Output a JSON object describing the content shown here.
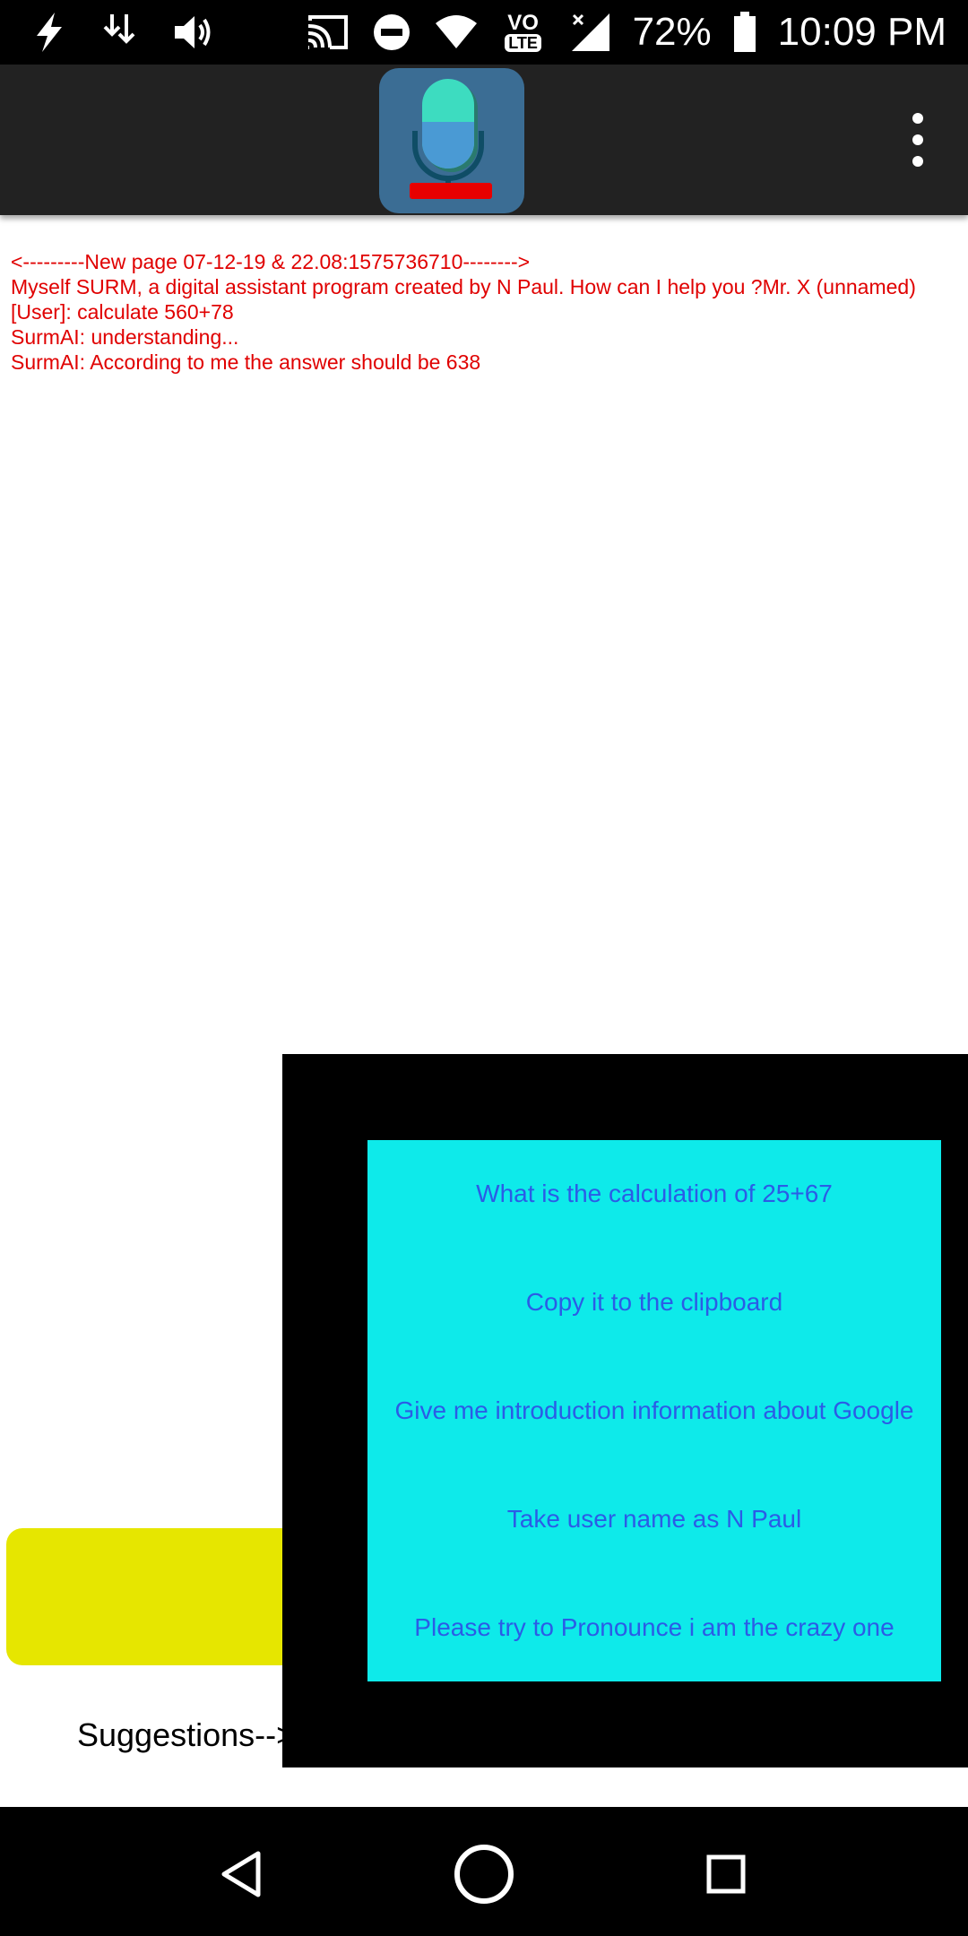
{
  "status_bar": {
    "battery_percent": "72%",
    "time": "10:09 PM",
    "network_badge": "LTE",
    "network_top": "VO",
    "icons": [
      "flash-icon",
      "download-icon",
      "volume-icon",
      "cast-icon",
      "do-not-disturb-icon",
      "wifi-icon",
      "volte-icon",
      "signal-icon",
      "battery-icon"
    ]
  },
  "app_bar": {
    "logo_icon": "microphone-icon",
    "menu_icon": "overflow-menu-icon"
  },
  "log": {
    "lines": [
      "<---------New page 07-12-19 & 22.08:1575736710-------->",
      "Myself SURM, a digital assistant program created by N Paul. How can I help you ?Mr. X (unnamed)",
      "[User]: calculate 560+78",
      "SurmAI: understanding...",
      "SurmAI: According to me the answer should be 638"
    ]
  },
  "suggestions": {
    "label": "Suggestions-->",
    "items": [
      "What is the calculation of 25+67",
      "Copy it to the clipboard",
      "Give me introduction information about Google",
      "Take user name as N Paul",
      "Please try to Pronounce i am the crazy one"
    ]
  },
  "colors": {
    "log_text": "#e00000",
    "popup_bg": "#0eeaea",
    "popup_text": "#2b5ce6",
    "input_bg": "#e6e600"
  },
  "nav_bar": {
    "icons": [
      "back-icon",
      "home-icon",
      "recents-icon"
    ]
  }
}
